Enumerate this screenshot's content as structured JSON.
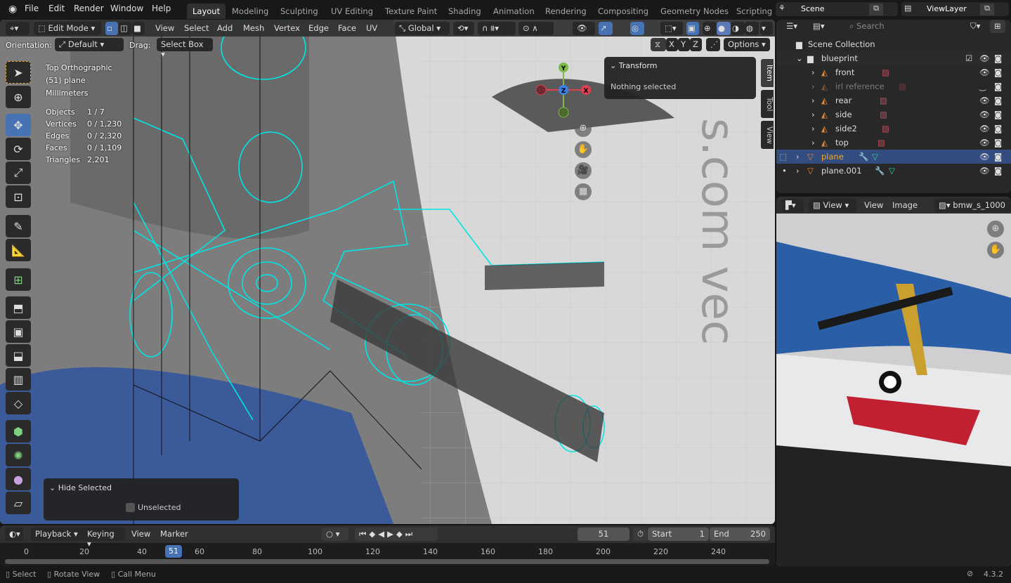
{
  "topbar": {
    "menus": [
      "File",
      "Edit",
      "Render",
      "Window",
      "Help"
    ],
    "workspaces": [
      "Layout",
      "Modeling",
      "Sculpting",
      "UV Editing",
      "Texture Paint",
      "Shading",
      "Animation",
      "Rendering",
      "Compositing",
      "Geometry Nodes",
      "Scripting"
    ],
    "active_workspace": "Layout",
    "scene": "Scene",
    "view_layer": "ViewLayer"
  },
  "viewport": {
    "header": {
      "mode": "Edit Mode",
      "menus": [
        "View",
        "Select",
        "Add",
        "Mesh",
        "Vertex",
        "Edge",
        "Face",
        "UV"
      ],
      "transform_orientation": "Global"
    },
    "tool_settings": {
      "orientation_label": "Orientation:",
      "orientation": "Default",
      "drag_label": "Drag:",
      "drag": "Select Box",
      "axes": [
        "X",
        "Y",
        "Z"
      ],
      "options": "Options"
    },
    "overlay": {
      "view": "Top Orthographic",
      "object": "(51) plane",
      "units": "Millimeters",
      "stats": [
        {
          "label": "Objects",
          "value": "1 / 7"
        },
        {
          "label": "Vertices",
          "value": "0 / 1,230"
        },
        {
          "label": "Edges",
          "value": "0 / 2,320"
        },
        {
          "label": "Faces",
          "value": "0 / 1,109"
        },
        {
          "label": "Triangles",
          "value": "2,201"
        }
      ]
    },
    "gizmo": {
      "x": "X",
      "y": "Y",
      "z": "Z"
    },
    "n_tabs": [
      "Item",
      "Tool",
      "View"
    ],
    "transform_panel": {
      "title": "Transform",
      "message": "Nothing selected"
    },
    "last_op": {
      "title": "Hide Selected",
      "option": "Unselected",
      "checked": false
    },
    "tools": [
      "select-box",
      "cursor",
      "move",
      "rotate",
      "scale",
      "transform",
      "annotate",
      "measure",
      "add-cube",
      "extrude",
      "inset",
      "bevel",
      "loop-cut",
      "knife",
      "poly-build",
      "spin",
      "smooth",
      "shear"
    ],
    "active_tool": "move",
    "backdrop_text": "s.com vec"
  },
  "timeline": {
    "menus": [
      "Playback",
      "Keying",
      "View",
      "Marker"
    ],
    "current_frame": "51",
    "start_label": "Start",
    "start": "1",
    "end_label": "End",
    "end": "250",
    "ticks": [
      "0",
      "20",
      "40",
      "60",
      "80",
      "100",
      "120",
      "140",
      "160",
      "180",
      "200",
      "220",
      "240"
    ]
  },
  "status": {
    "hints": [
      "Select",
      "Rotate View",
      "Call Menu"
    ],
    "version": "4.3.2"
  },
  "outliner": {
    "search_placeholder": "Search",
    "root": "Scene Collection",
    "collection": "blueprint",
    "items": [
      {
        "name": "front",
        "type": "image"
      },
      {
        "name": "irl reference",
        "type": "image",
        "hidden": true
      },
      {
        "name": "rear",
        "type": "image"
      },
      {
        "name": "side",
        "type": "image"
      },
      {
        "name": "side2",
        "type": "image"
      },
      {
        "name": "top",
        "type": "image"
      }
    ],
    "objects": [
      {
        "name": "plane",
        "selected": true
      },
      {
        "name": "plane.001",
        "selected": false
      }
    ]
  },
  "image_editor": {
    "view_menu": "View",
    "menus": [
      "View",
      "Image"
    ],
    "image_name": "bmw_s_1000"
  },
  "colors": {
    "accent": "#4772b3",
    "wire": "#00e5e5",
    "selected_text": "#f5a623"
  }
}
